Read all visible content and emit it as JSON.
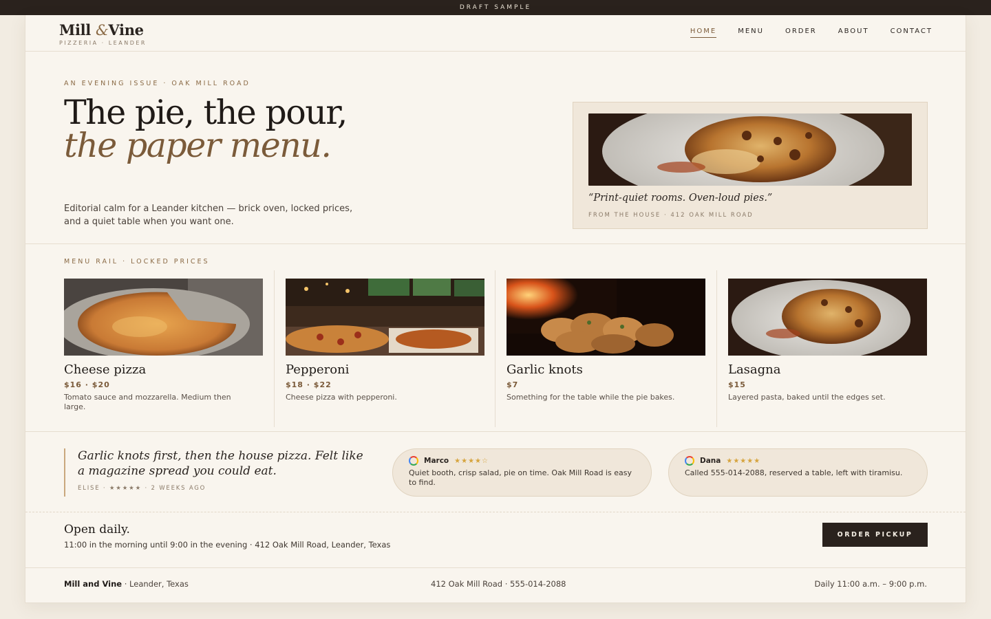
{
  "topbar": {
    "label": "DRAFT SAMPLE"
  },
  "brand": {
    "name_1": "Mill",
    "amp": "&",
    "name_2": "Vine",
    "sub": "PIZZERIA · LEANDER"
  },
  "nav": {
    "items": [
      "HOME",
      "MENU",
      "ORDER",
      "ABOUT",
      "CONTACT"
    ],
    "active": "HOME"
  },
  "hero": {
    "eyebrow": "AN EVENING ISSUE · OAK MILL ROAD",
    "title_1": "The pie, the pour,",
    "title_em": "the paper menu.",
    "lede": "Editorial calm for a Leander kitchen — brick oven, locked prices, and a quiet table when you want one.",
    "card_quote": "“Print-quiet rooms. Oven-loud pies.”",
    "card_meta": "FROM THE HOUSE · 412 OAK MILL ROAD"
  },
  "menu": {
    "eyebrow": "MENU RAIL · LOCKED PRICES",
    "items": [
      {
        "name": "Cheese pizza",
        "price": "$16 · $20",
        "desc": "Tomato sauce and mozzarella. Medium then large.",
        "photo": "cheese-pizza-photo"
      },
      {
        "name": "Pepperoni",
        "price": "$18 · $22",
        "desc": "Cheese pizza with pepperoni.",
        "photo": "pepperoni-bar-photo"
      },
      {
        "name": "Garlic knots",
        "price": "$7",
        "desc": "Something for the table while the pie bakes.",
        "photo": "garlic-knots-photo"
      },
      {
        "name": "Lasagna",
        "price": "$15",
        "desc": "Layered pasta, baked until the edges set.",
        "photo": "lasagna-photo"
      }
    ]
  },
  "reviews": {
    "featured": {
      "quote": "Garlic knots first, then the house pizza. Felt like a magazine spread you could eat.",
      "meta": "ELISE · ★★★★★ · 2 WEEKS AGO"
    },
    "pills": [
      {
        "name": "Marco",
        "stars": "★★★★☆",
        "rating": 4,
        "text": "Quiet booth, crisp salad, pie on time. Oak Mill Road is easy to find."
      },
      {
        "name": "Dana",
        "stars": "★★★★★",
        "rating": 5,
        "text": "Called 555-014-2088, reserved a table, left with tiramisu."
      }
    ]
  },
  "hours": {
    "title": "Open daily.",
    "text": "11:00 in the morning until 9:00 in the evening · 412 Oak Mill Road, Leander, Texas",
    "button": "ORDER PICKUP"
  },
  "footer": {
    "name": "Mill and Vine",
    "city": " · Leander, Texas",
    "contact": "412 Oak Mill Road · 555-014-2088",
    "hours": "Daily 11:00 a.m. – 9:00 p.m."
  },
  "colors": {
    "accent": "#7b5b3a",
    "dark": "#2a221d",
    "paper": "#f9f5ee",
    "card": "#f0e7da",
    "star": "#d6a43e"
  }
}
